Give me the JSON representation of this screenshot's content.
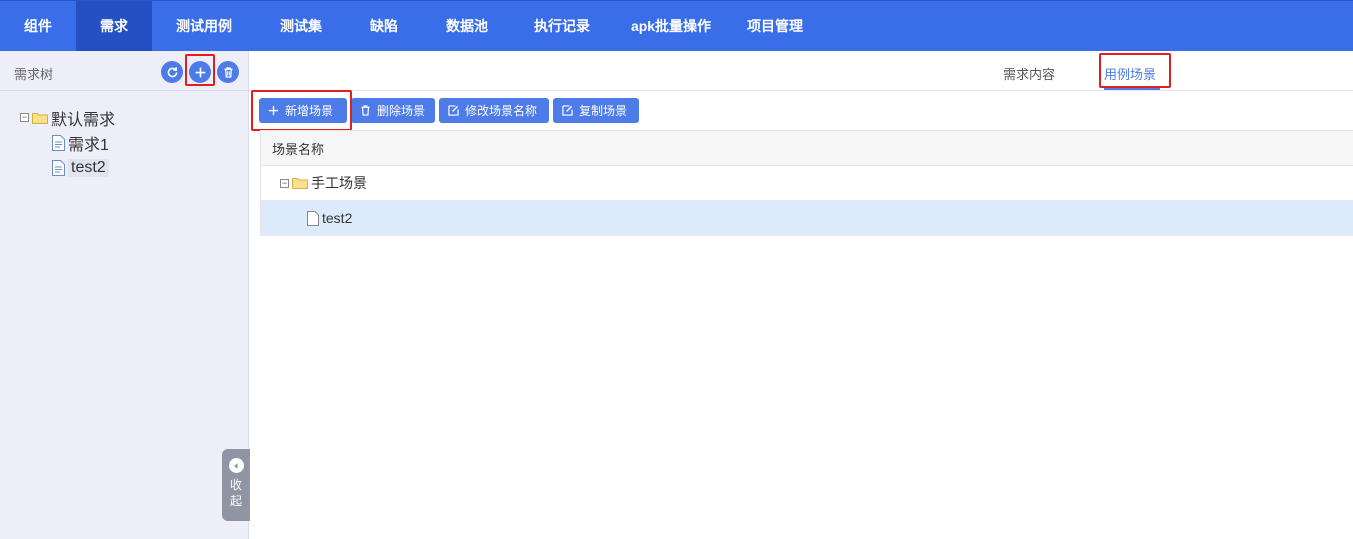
{
  "nav": {
    "items": [
      {
        "label": "组件"
      },
      {
        "label": "需求"
      },
      {
        "label": "测试用例"
      },
      {
        "label": "测试集"
      },
      {
        "label": "缺陷"
      },
      {
        "label": "数据池"
      },
      {
        "label": "执行记录"
      },
      {
        "label": "apk批量操作"
      },
      {
        "label": "项目管理"
      }
    ],
    "active_index": 1
  },
  "sidebar": {
    "title": "需求树",
    "buttons": {
      "refresh_icon": "refresh-icon",
      "add_icon": "plus-icon",
      "delete_icon": "trash-icon"
    },
    "tree": {
      "root": {
        "label": "默认需求",
        "expanded": true
      },
      "children": [
        {
          "label": "需求1"
        },
        {
          "label": "test2",
          "selected": true
        }
      ]
    },
    "collapse_label": "收起"
  },
  "main": {
    "tabs": [
      {
        "label": "需求内容"
      },
      {
        "label": "用例场景",
        "active": true
      }
    ],
    "toolbar": {
      "add_label": "新增场景",
      "delete_label": "删除场景",
      "rename_label": "修改场景名称",
      "copy_label": "复制场景"
    },
    "grid": {
      "column_header": "场景名称",
      "rows": [
        {
          "label": "手工场景",
          "type": "folder",
          "expanded": true
        },
        {
          "label": "test2",
          "type": "file",
          "selected": true
        }
      ]
    }
  },
  "colors": {
    "nav_bg": "#3a6ee8",
    "nav_active": "#2450c4",
    "accent": "#4d7ce8",
    "sidebar_bg": "#eeeef8",
    "highlight": "#e02020",
    "row_selected": "#dcebfb"
  }
}
